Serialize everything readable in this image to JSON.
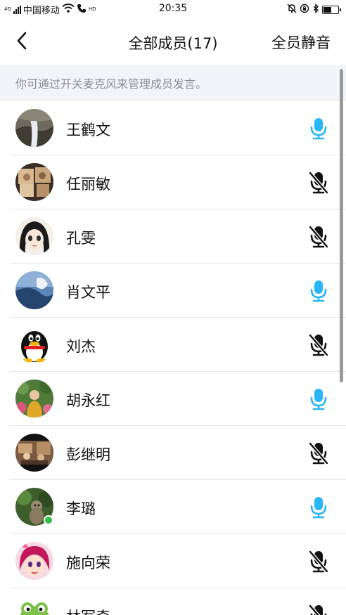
{
  "status_bar": {
    "network_label": "4G",
    "carrier": "中国移动",
    "hd_label": "HD",
    "time": "20:35"
  },
  "header": {
    "title": "全部成员(17)",
    "mute_all_label": "全员静音"
  },
  "hint_text": "你可通过开关麦克风来管理成员发言。",
  "colors": {
    "mic_on": "#29b6f6",
    "mic_off": "#111111",
    "hint_bg": "#f3f4f7",
    "badge": "#2fbf4a"
  },
  "members": [
    {
      "name": "王鹤文",
      "mic": "on"
    },
    {
      "name": "任丽敏",
      "mic": "off"
    },
    {
      "name": "孔雯",
      "mic": "off"
    },
    {
      "name": "肖文平",
      "mic": "on"
    },
    {
      "name": "刘杰",
      "mic": "off"
    },
    {
      "name": "胡永红",
      "mic": "on"
    },
    {
      "name": "彭继明",
      "mic": "off"
    },
    {
      "name": "李璐",
      "mic": "on"
    },
    {
      "name": "施向荣",
      "mic": "off"
    },
    {
      "name": "林军奇",
      "mic": "off"
    }
  ]
}
